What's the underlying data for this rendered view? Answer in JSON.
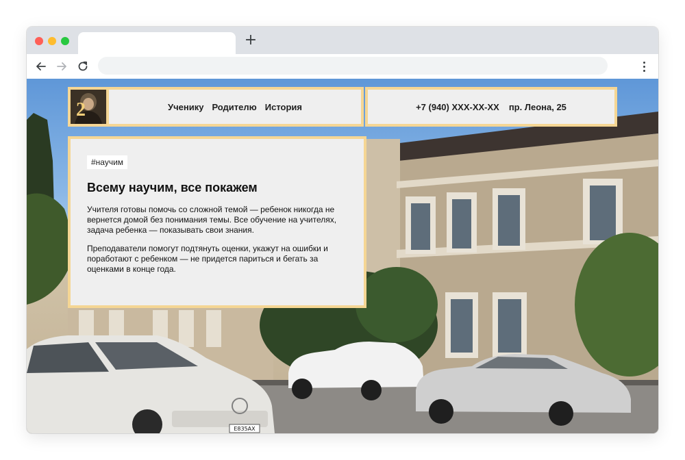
{
  "browser": {
    "tab_title": "",
    "new_tab_label": "+",
    "address": ""
  },
  "site": {
    "logo_number": "2",
    "nav": [
      "Ученику",
      "Родителю",
      "История"
    ],
    "phone": "+7 (940) XXX-XX-XX",
    "address": "пр. Леона, 25"
  },
  "card": {
    "tag": "#научим",
    "title": "Всему научим, все покажем",
    "paragraphs": [
      "Учителя готовы помочь со сложной темой — ребенок никогда не вернется домой без понимания темы. Все обучение на учителях, задача ребенка — показывать свои знания.",
      "Преподаватели помогут подтянуть оценки, укажут на ошибки и поработают с ребенком — не придется париться и бегать за оценками в конце года."
    ]
  },
  "photo": {
    "plate": "Е835АХ"
  },
  "colors": {
    "accent_border": "#f5d694",
    "panel": "#efefef",
    "tabbar": "#dee1e6"
  }
}
